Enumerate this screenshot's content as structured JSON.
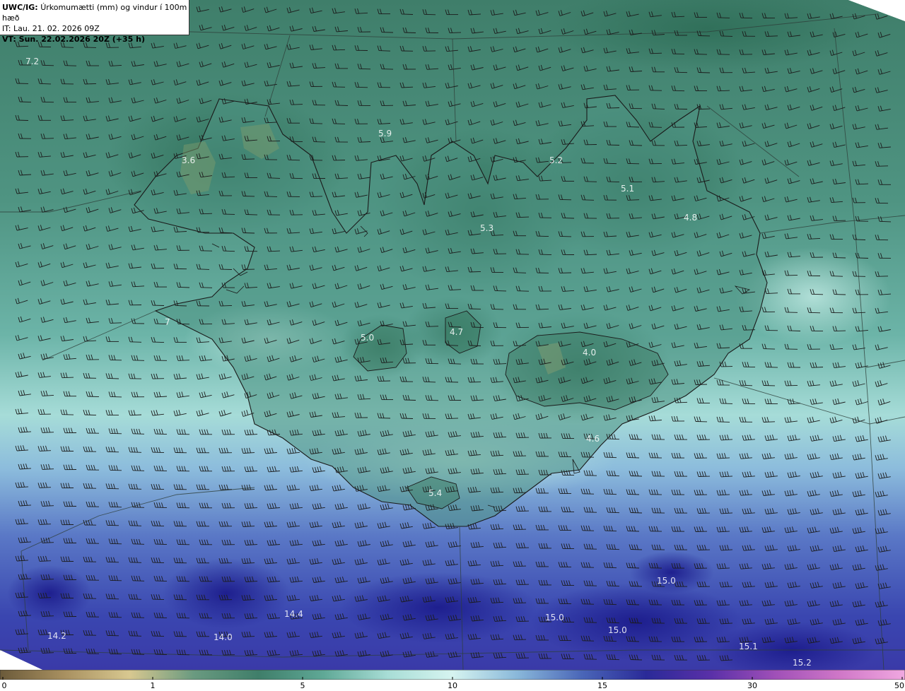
{
  "header": {
    "product_code": "UWC/IG:",
    "product_desc": "Úrkomumætti (mm) og vindur í 100m hæð",
    "init_time": "IT: Lau. 21. 02. 2026 09Z",
    "valid_time": "VT: Sun. 22.02.2026 20Z (+35 h)"
  },
  "value_labels": [
    "7.2",
    "5.9",
    "3.6",
    "5.2",
    "5.1",
    "4.8",
    "5.3",
    "7",
    "5.0",
    "4.7",
    "4.0",
    "4.6",
    "5.4",
    "15.0",
    "14.4",
    "15.0",
    "15.0",
    "14.2",
    "14.0",
    "15.1",
    "15.2"
  ],
  "colorbar": {
    "ticks": [
      {
        "label": "0",
        "value": 0
      },
      {
        "label": "1",
        "value": 1
      },
      {
        "label": "5",
        "value": 5
      },
      {
        "label": "10",
        "value": 10
      },
      {
        "label": "15",
        "value": 15
      },
      {
        "label": "30",
        "value": 30
      },
      {
        "label": "50",
        "value": 50
      }
    ],
    "colors": [
      "#6b5a3a",
      "#a89060",
      "#d8c890",
      "#6a9a80",
      "#3f7e6a",
      "#5fa896",
      "#a8ddd6",
      "#d6f4f0",
      "#8ab8da",
      "#4a66b8",
      "#2a2a98",
      "#5a30a8",
      "#a050b8",
      "#d078c8",
      "#f0a8e0"
    ]
  },
  "colors": {
    "land_outline": "#1a1a1a",
    "grid_line": "#2e3e3a",
    "barb": "#1c1c1c"
  }
}
